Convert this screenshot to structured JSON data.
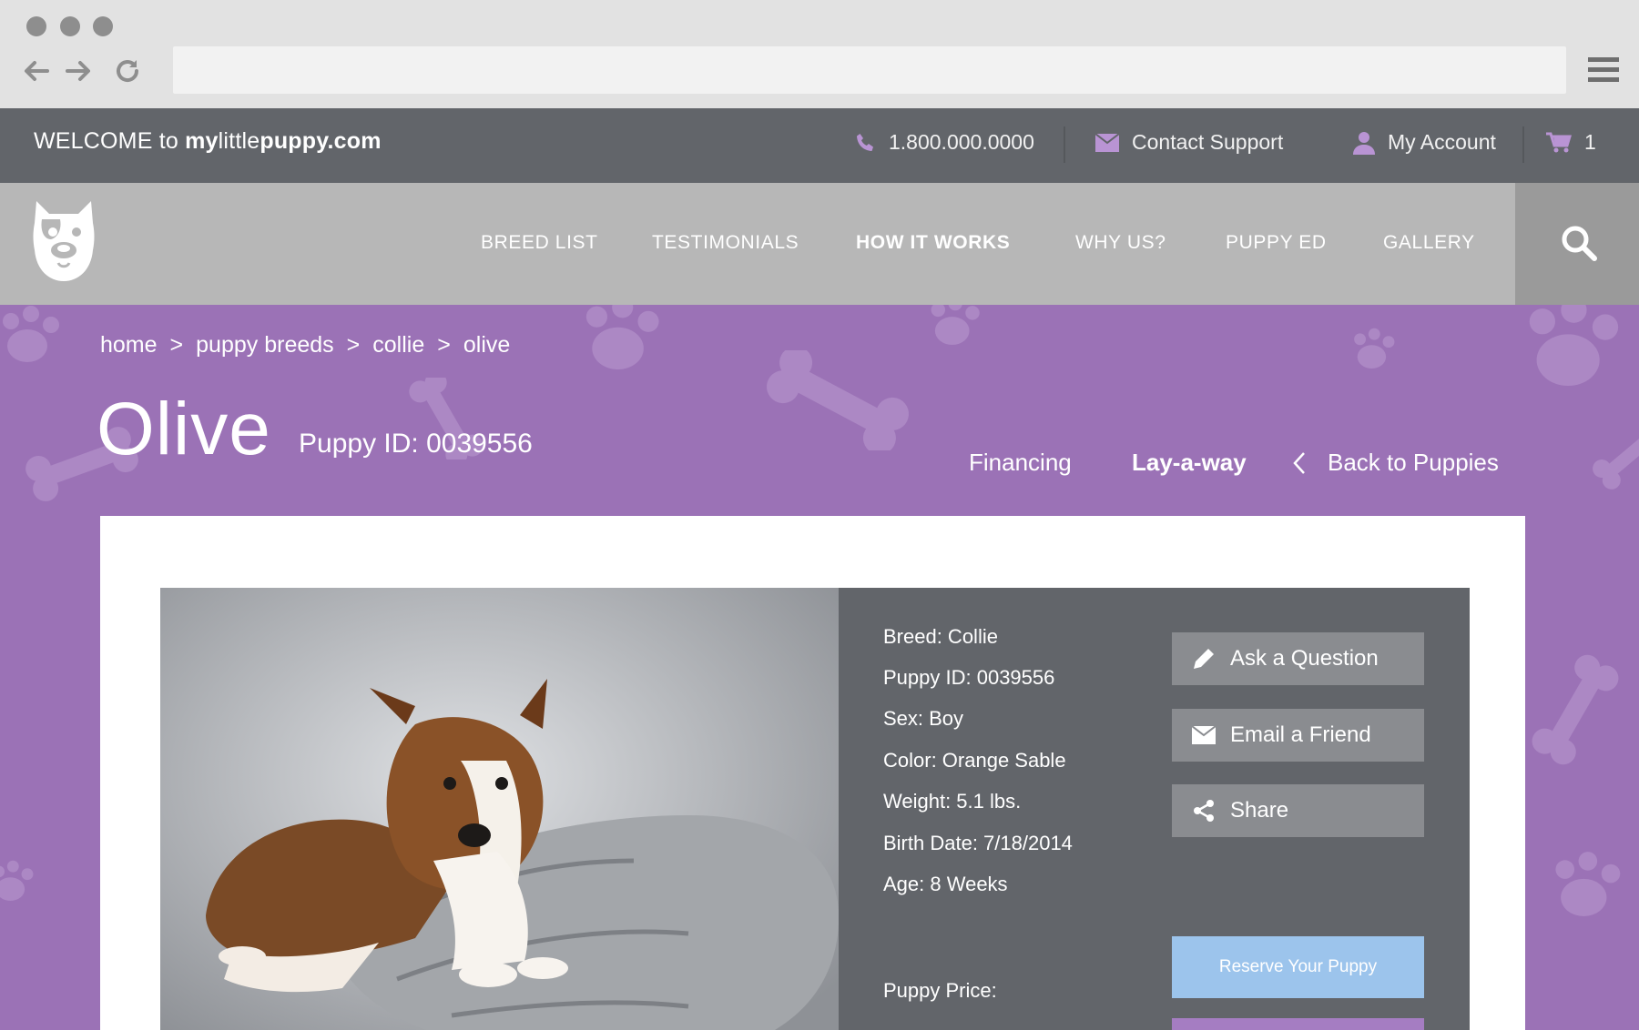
{
  "topbar": {
    "welcome_prefix": "WELCOME to ",
    "site_a": "my",
    "site_b": "little",
    "site_c": "puppy.com",
    "phone": "1.800.000.0000",
    "contact": "Contact Support",
    "account": "My Account",
    "cart_count": "1"
  },
  "nav": {
    "items": [
      "BREED LIST",
      "TESTIMONIALS",
      "HOW IT WORKS",
      "WHY US?",
      "PUPPY ED",
      "GALLERY"
    ],
    "active": "HOW IT WORKS"
  },
  "breadcrumb": {
    "home": "home",
    "sep": ">",
    "breeds": "puppy breeds",
    "breed": "collie",
    "current": "olive"
  },
  "puppy": {
    "name": "Olive",
    "id_label": "Puppy ID: 0039556",
    "facts": [
      "Breed: Collie",
      "Puppy ID: 0039556",
      "Sex: Boy",
      "Color: Orange Sable",
      "Weight: 5.1 lbs.",
      "Birth Date: 7/18/2014",
      "Age: 8 Weeks"
    ],
    "price_label": "Puppy Price:"
  },
  "hero_links": {
    "financing": "Financing",
    "layaway": "Lay-a-way",
    "back": "Back to Puppies"
  },
  "actions": {
    "ask": "Ask a Question",
    "email": "Email a Friend",
    "share": "Share",
    "reserve": "Reserve Your Puppy"
  },
  "colors": {
    "brand_purple": "#9b72b6",
    "topbar": "#62656a",
    "nav": "#b7b7b7",
    "reserve": "#9cc4ec",
    "accent_icon": "#b994d4"
  }
}
